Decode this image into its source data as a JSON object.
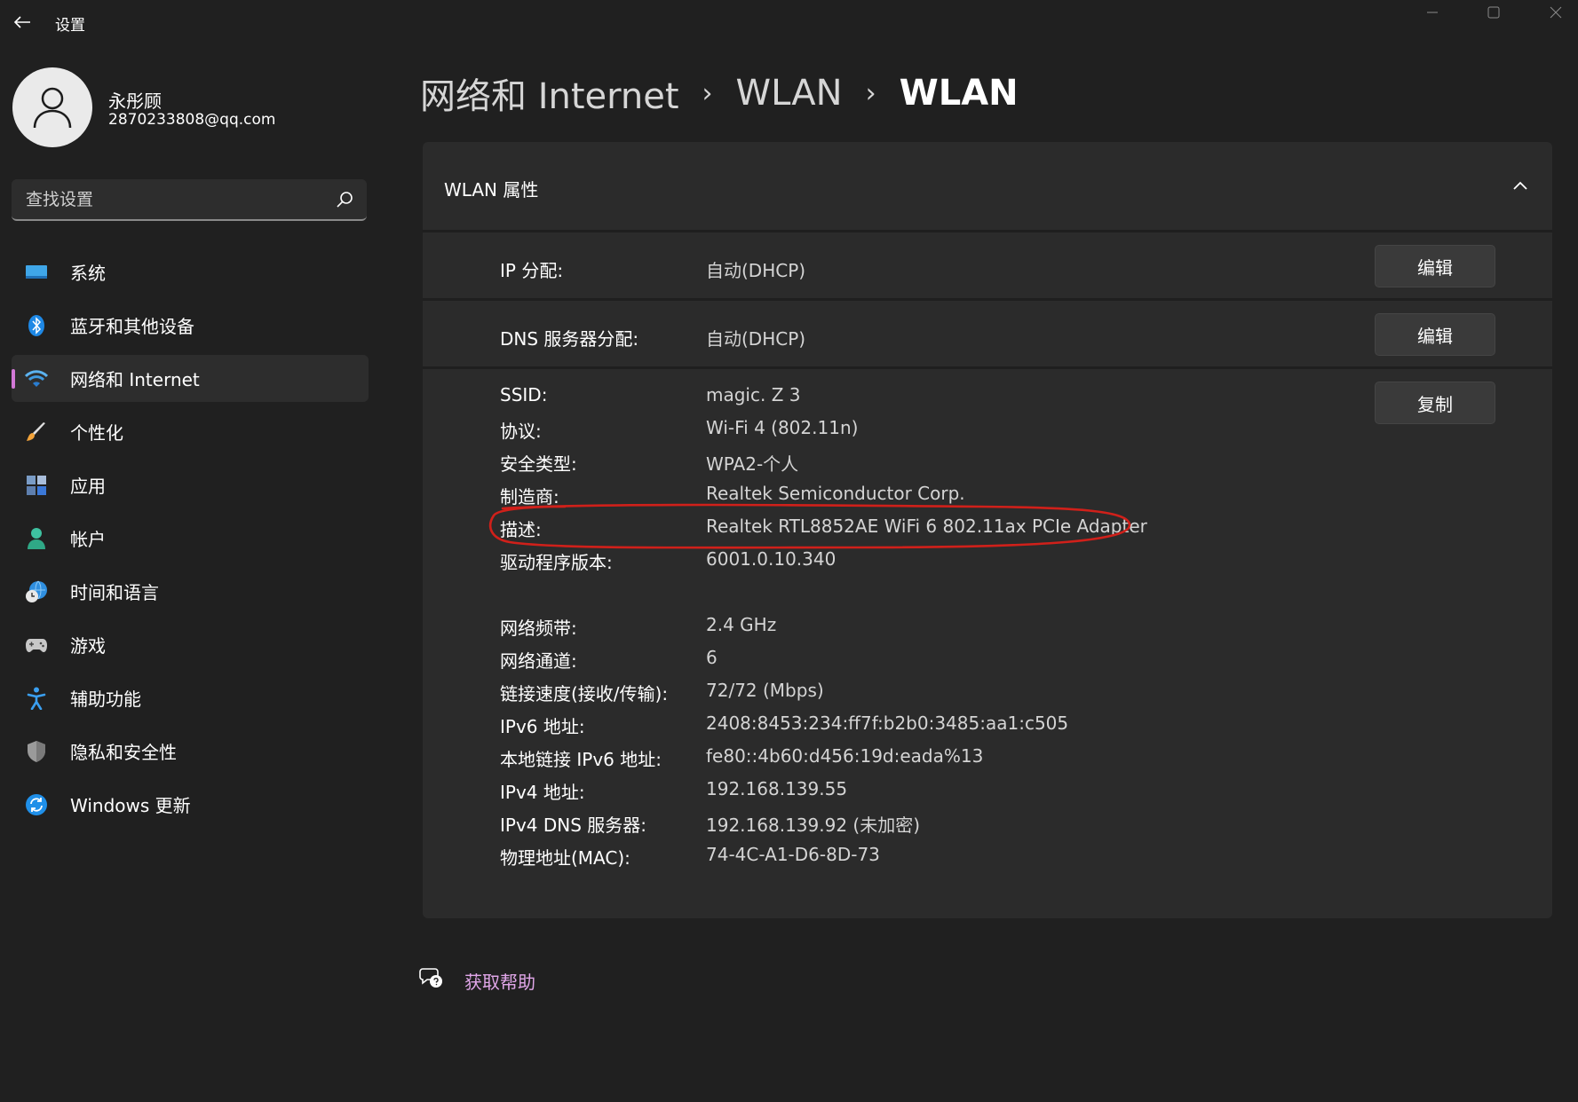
{
  "titlebar": {
    "app_title": "设置",
    "icons": [
      "back-arrow-icon",
      "minimize-icon",
      "maximize-icon",
      "close-icon"
    ]
  },
  "profile": {
    "name": "永彤顾",
    "email": "2870233808@qq.com"
  },
  "search": {
    "placeholder": "查找设置"
  },
  "sidebar": {
    "items": [
      {
        "label": "系统",
        "icon": "system-display-icon",
        "active": false
      },
      {
        "label": "蓝牙和其他设备",
        "icon": "bluetooth-icon",
        "active": false
      },
      {
        "label": "网络和 Internet",
        "icon": "wifi-icon",
        "active": true
      },
      {
        "label": "个性化",
        "icon": "paintbrush-icon",
        "active": false
      },
      {
        "label": "应用",
        "icon": "apps-icon",
        "active": false
      },
      {
        "label": "帐户",
        "icon": "account-icon",
        "active": false
      },
      {
        "label": "时间和语言",
        "icon": "globe-clock-icon",
        "active": false
      },
      {
        "label": "游戏",
        "icon": "gamepad-icon",
        "active": false
      },
      {
        "label": "辅助功能",
        "icon": "accessibility-icon",
        "active": false
      },
      {
        "label": "隐私和安全性",
        "icon": "shield-icon",
        "active": false
      },
      {
        "label": "Windows 更新",
        "icon": "windows-update-icon",
        "active": false
      }
    ]
  },
  "breadcrumb": {
    "level1": "网络和 Internet",
    "level2": "WLAN",
    "current": "WLAN",
    "separator": "›"
  },
  "properties": {
    "title": "WLAN 属性",
    "ip_row": {
      "label": "IP 分配:",
      "value": "自动(DHCP)",
      "button": "编辑"
    },
    "dns_row": {
      "label": "DNS 服务器分配:",
      "value": "自动(DHCP)",
      "button": "编辑"
    },
    "copy_button": "复制",
    "details": [
      {
        "label": "SSID:",
        "value": "magic. Z 3"
      },
      {
        "label": "协议:",
        "value": "Wi-Fi 4 (802.11n)"
      },
      {
        "label": "安全类型:",
        "value": "WPA2-个人"
      },
      {
        "label": "制造商:",
        "value": "Realtek Semiconductor Corp."
      },
      {
        "label": "描述:",
        "value": "Realtek RTL8852AE WiFi 6 802.11ax PCIe Adapter"
      },
      {
        "label": "驱动程序版本:",
        "value": "6001.0.10.340"
      },
      {
        "label": "网络频带:",
        "value": "2.4 GHz"
      },
      {
        "label": "网络通道:",
        "value": "6"
      },
      {
        "label": "链接速度(接收/传输):",
        "value": "72/72 (Mbps)"
      },
      {
        "label": "IPv6 地址:",
        "value": "2408:8453:234:ff7f:b2b0:3485:aa1:c505"
      },
      {
        "label": "本地链接 IPv6 地址:",
        "value": "fe80::4b60:d456:19d:eada%13"
      },
      {
        "label": "IPv4 地址:",
        "value": "192.168.139.55"
      },
      {
        "label": "IPv4 DNS 服务器:",
        "value": "192.168.139.92 (未加密)"
      },
      {
        "label": "物理地址(MAC):",
        "value": "74-4C-A1-D6-8D-73"
      }
    ]
  },
  "help": {
    "label": "获取帮助",
    "icon": "help-chat-icon"
  },
  "colors": {
    "background": "#202020",
    "card": "#2b2b2b",
    "accent": "#d278d6",
    "link": "#e0a6e8",
    "annotation": "#d0201a"
  }
}
